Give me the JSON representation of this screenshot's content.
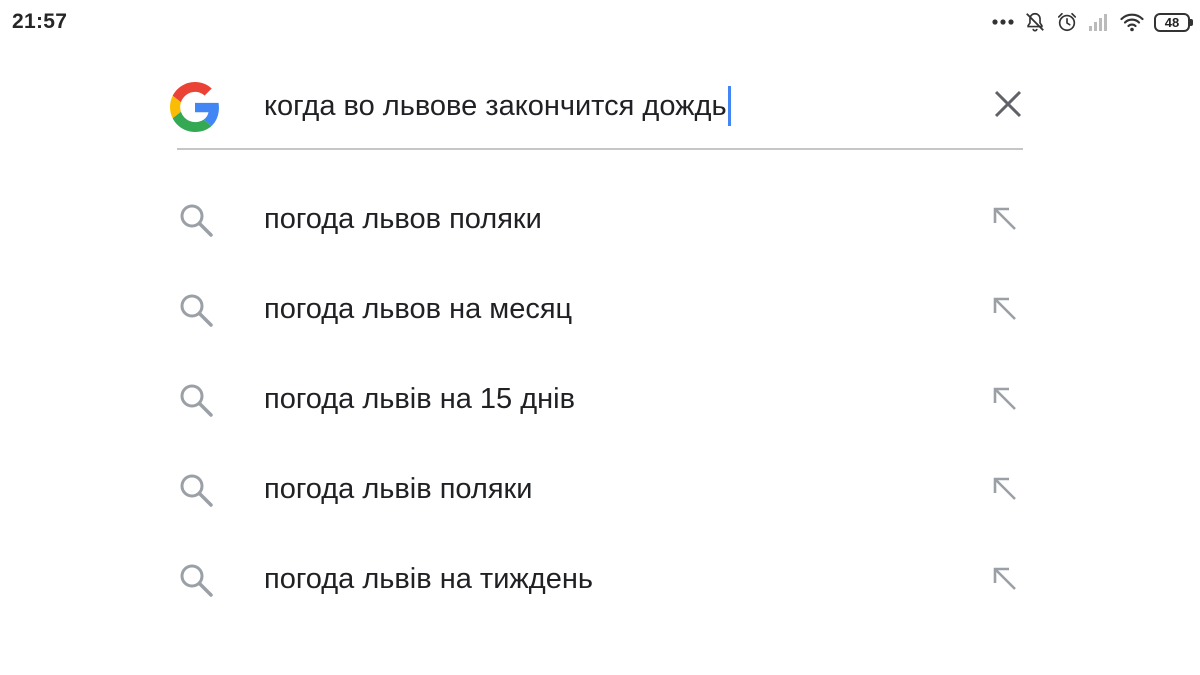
{
  "status_bar": {
    "time": "21:57",
    "battery": "48",
    "icons": [
      "more-dots-icon",
      "notifications-off-icon",
      "alarm-icon",
      "signal-icon",
      "wifi-icon",
      "battery-icon"
    ]
  },
  "search": {
    "engine_logo": "google-g-icon",
    "query": "когда во львове закончится дождь",
    "clear_icon": "close-icon",
    "colors": {
      "blue": "#4285F4",
      "red": "#EA4335",
      "yellow": "#FBBC05",
      "green": "#34A853",
      "caret": "#4285F4",
      "divider": "#c6c6c6",
      "icon_gray": "#9aa0a6"
    }
  },
  "suggestions": [
    {
      "text": "погода львов поляки",
      "icon": "search-icon",
      "action_icon": "arrow-up-left-icon"
    },
    {
      "text": "погода львов на месяц",
      "icon": "search-icon",
      "action_icon": "arrow-up-left-icon"
    },
    {
      "text": "погода львів на 15 днів",
      "icon": "search-icon",
      "action_icon": "arrow-up-left-icon"
    },
    {
      "text": "погода львів поляки",
      "icon": "search-icon",
      "action_icon": "arrow-up-left-icon"
    },
    {
      "text": "погода львів на тиждень",
      "icon": "search-icon",
      "action_icon": "arrow-up-left-icon"
    }
  ]
}
